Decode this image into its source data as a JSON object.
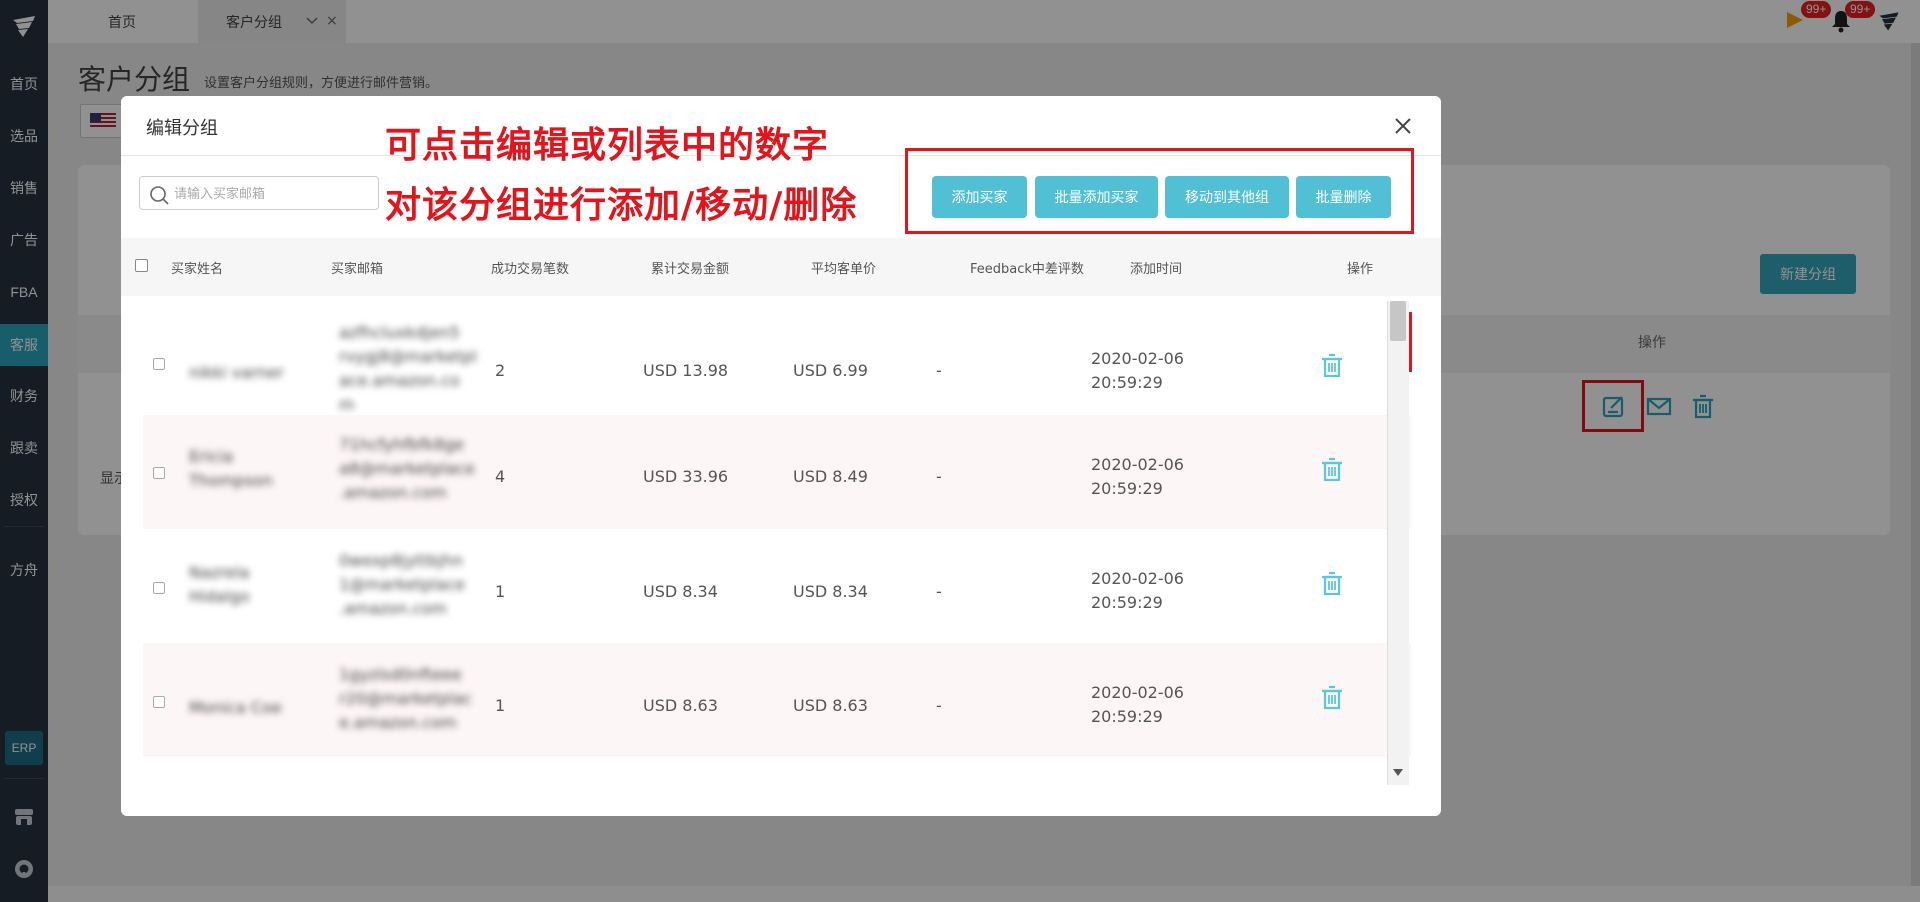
{
  "sidebar": {
    "items": [
      {
        "label": "首页"
      },
      {
        "label": "选品"
      },
      {
        "label": "销售"
      },
      {
        "label": "广告"
      },
      {
        "label": "FBA"
      },
      {
        "label": "客服"
      },
      {
        "label": "财务"
      },
      {
        "label": "跟卖"
      },
      {
        "label": "授权"
      },
      {
        "label": "方舟"
      }
    ],
    "erp_label": "ERP"
  },
  "topbar": {
    "tabs": [
      {
        "label": "首页"
      },
      {
        "label": "客户分组"
      }
    ],
    "close_glyph": "×",
    "badges": {
      "flag_count": "99+",
      "bell_count": "99+"
    }
  },
  "page": {
    "title": "客户分组",
    "subtitle": "设置客户分组规则，方便进行邮件营销。",
    "new_group_button": "新建分组",
    "table_op_header": "操作",
    "show_text": "显示"
  },
  "modal": {
    "title": "编辑分组",
    "search_placeholder": "请输入买家邮箱",
    "buttons": {
      "add_buyer": "添加买家",
      "batch_add_buyer": "批量添加买家",
      "move_to_group": "移动到其他组",
      "batch_delete": "批量删除"
    },
    "annotation": {
      "line1": "可点击编辑或列表中的数字",
      "line2": "对该分组进行添加/移动/删除"
    },
    "columns": [
      "买家姓名",
      "买家邮箱",
      "成功交易笔数",
      "累计交易金额",
      "平均客单价",
      "Feedback中差评数",
      "添加时间",
      "操作"
    ],
    "rows": [
      {
        "name": "nikki varner",
        "email": "azfhcluxkdjen5 rvygj8@marketpl ace.amazon.co m",
        "count": "2",
        "total": "USD 13.98",
        "avg": "USD 6.99",
        "feedback": "-",
        "date": "2020-02-06",
        "time": "20:59:29"
      },
      {
        "name": "Ericia Thompson",
        "email": "71hcfyhfbfk8ge a8@marketplace .amazon.com",
        "count": "4",
        "total": "USD 33.96",
        "avg": "USD 8.49",
        "feedback": "-",
        "date": "2020-02-06",
        "time": "20:59:29"
      },
      {
        "name": "Nazrela Hidalgo",
        "email": "0wexp8jyttbjhn 1@marketplace .amazon.com",
        "count": "1",
        "total": "USD 8.34",
        "avg": "USD 8.34",
        "feedback": "-",
        "date": "2020-02-06",
        "time": "20:59:29"
      },
      {
        "name": "Monica Coe",
        "email": "1gyzlsd0nfteee r20@marketplac e.amazon.com",
        "count": "1",
        "total": "USD 8.63",
        "avg": "USD 8.63",
        "feedback": "-",
        "date": "2020-02-06",
        "time": "20:59:29"
      }
    ]
  },
  "colors": {
    "sidebar_bg": "#253240",
    "accent": "#2aa4be",
    "button": "#52c0d4",
    "annotation_red": "#e3141c",
    "badge_red": "#e62020"
  }
}
